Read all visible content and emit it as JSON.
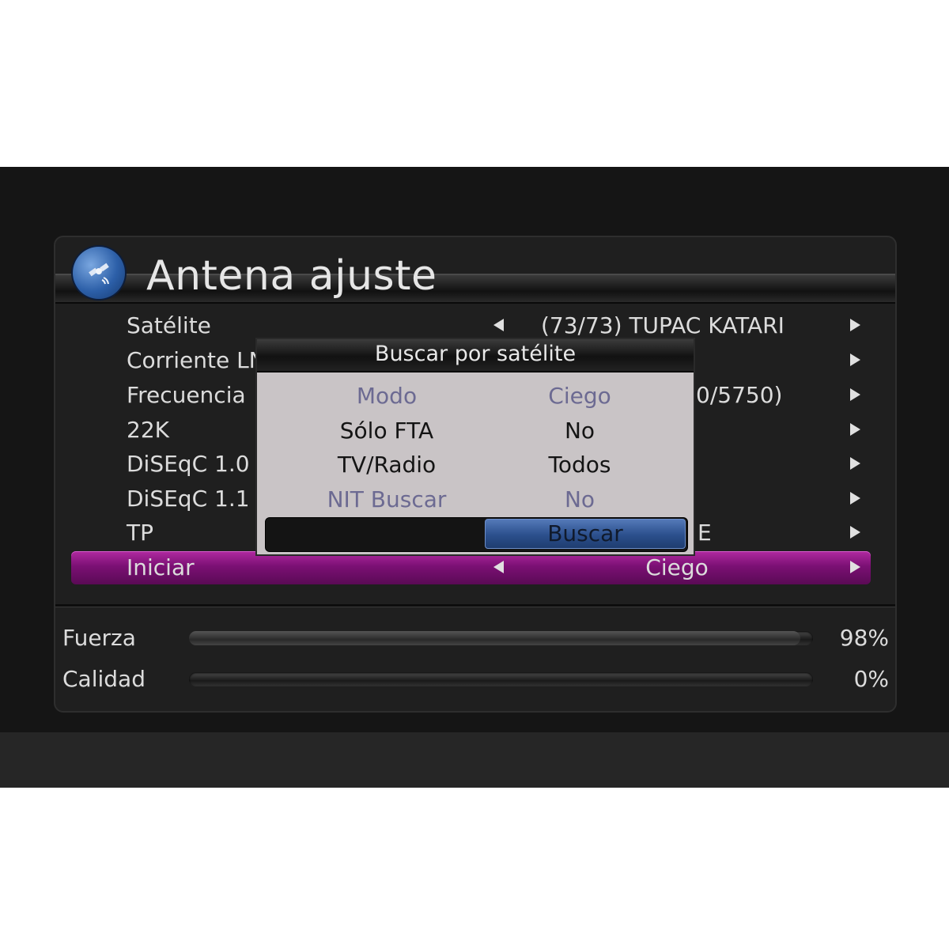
{
  "header": {
    "title": "Antena ajuste",
    "logo_icon": "satellite-icon"
  },
  "rows": [
    {
      "label": "Satélite",
      "value": "(73/73) TUPAC KATARI"
    },
    {
      "label": "Corriente LN",
      "value": ""
    },
    {
      "label": "Frecuencia",
      "value": "0/5750)"
    },
    {
      "label": "22K",
      "value": ""
    },
    {
      "label": "DiSEqC 1.0",
      "value": ""
    },
    {
      "label": "DiSEqC 1.1",
      "value": ""
    },
    {
      "label": "TP",
      "value": "E"
    },
    {
      "label": "Iniciar",
      "value": "Ciego"
    }
  ],
  "meters": [
    {
      "label": "Fuerza",
      "value_text": "98%",
      "fraction": 0.98
    },
    {
      "label": "Calidad",
      "value_text": "0%",
      "fraction": 0.0
    }
  ],
  "dialog": {
    "title": "Buscar por satélite",
    "items": [
      {
        "label": "Modo",
        "value": "Ciego"
      },
      {
        "label": "Sólo FTA",
        "value": "No"
      },
      {
        "label": "TV/Radio",
        "value": "Todos"
      },
      {
        "label": "NIT Buscar",
        "value": "No"
      }
    ],
    "button_label": "Buscar"
  },
  "colors": {
    "highlight": "#7b1074",
    "dialog_bg": "#c9c4c6",
    "dialog_dim_text": "#6c6a92",
    "button": "#2b4f8c"
  }
}
